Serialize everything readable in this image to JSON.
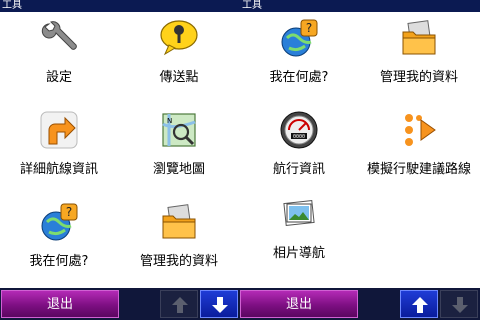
{
  "titlebar": {
    "left_title": "工具",
    "center_title": "工具"
  },
  "tiles": [
    {
      "label": "設定",
      "icon": "wrench-icon"
    },
    {
      "label": "傳送點",
      "icon": "pushpin-speech-bubble-icon"
    },
    {
      "label": "我在何處?",
      "icon": "globe-question-icon"
    },
    {
      "label": "管理我的資料",
      "icon": "folder-documents-icon"
    },
    {
      "label": "詳細航線資訊",
      "icon": "turn-arrow-icon"
    },
    {
      "label": "瀏覽地圖",
      "icon": "map-magnifier-icon"
    },
    {
      "label": "航行資訊",
      "icon": "trip-computer-gauge-icon"
    },
    {
      "label": "模擬行駛建議路線",
      "icon": "route-simulation-icon"
    },
    {
      "label": "我在何處?",
      "icon": "globe-question-icon"
    },
    {
      "label": "管理我的資料",
      "icon": "folder-documents-icon"
    },
    {
      "label": "相片導航",
      "icon": "photo-navigation-icon"
    }
  ],
  "bottombar": {
    "left_exit_label": "退出",
    "right_exit_label": "退出",
    "left_scroll_up_icon": "up-arrow-icon",
    "left_scroll_down_icon": "down-arrow-icon",
    "right_scroll_up_icon": "up-arrow-icon",
    "right_scroll_down_icon": "down-arrow-icon"
  },
  "colors": {
    "titlebar_bg": "#0b1a52",
    "exit_button": "#7d0f82",
    "active_arrow": "#1f3cd6"
  }
}
